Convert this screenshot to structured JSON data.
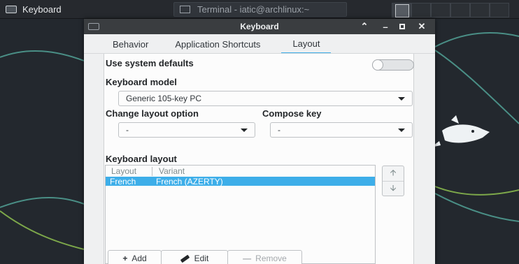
{
  "taskbar": {
    "app_label": "Keyboard",
    "terminal_label": "Terminal - iatic@archlinux:~"
  },
  "window": {
    "title": "Keyboard"
  },
  "tabs": [
    {
      "label": "Behavior"
    },
    {
      "label": "Application Shortcuts"
    },
    {
      "label": "Layout",
      "active": true
    }
  ],
  "layout": {
    "use_system_defaults_label": "Use system defaults",
    "use_system_defaults_on": false,
    "keyboard_model_label": "Keyboard model",
    "keyboard_model_value": "Generic 105-key PC",
    "change_layout_option_label": "Change layout option",
    "change_layout_option_value": "-",
    "compose_key_label": "Compose key",
    "compose_key_value": "-",
    "keyboard_layout_label": "Keyboard layout",
    "columns": [
      "Layout",
      "Variant"
    ],
    "rows": [
      {
        "layout": "French",
        "variant": "French (AZERTY)",
        "selected": true
      }
    ],
    "buttons": {
      "add": "Add",
      "edit": "Edit",
      "remove": "Remove"
    }
  },
  "colors": {
    "accent": "#3daee9",
    "titlebar": "#3a3d40",
    "desktop": "#23282e",
    "taskbar": "#26292e"
  }
}
